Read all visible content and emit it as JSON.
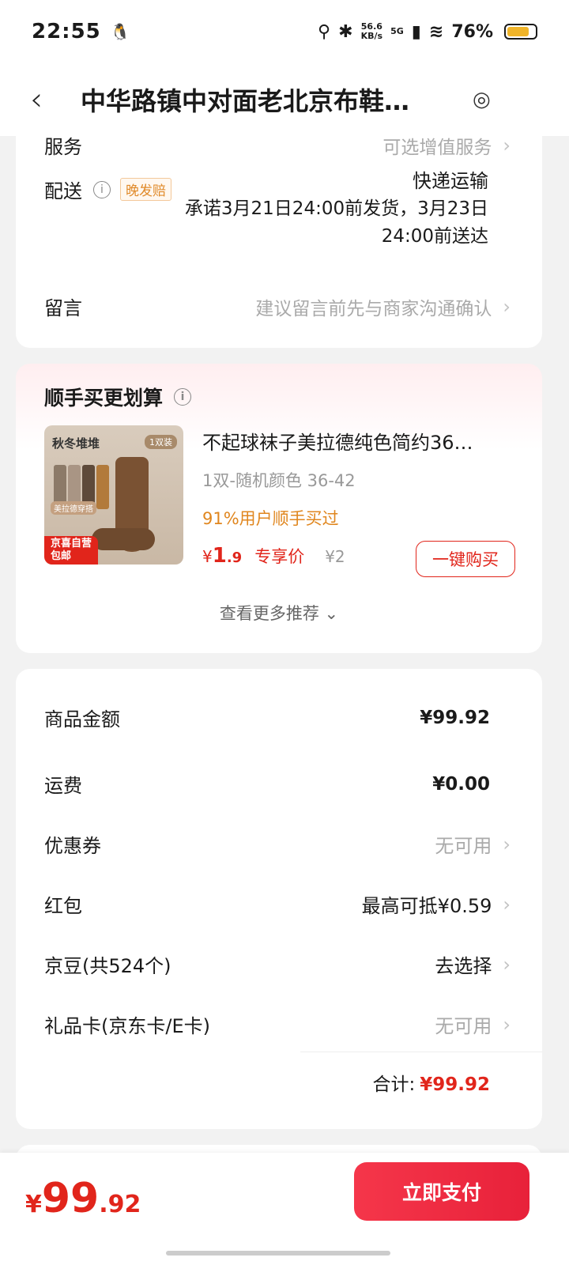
{
  "status_bar": {
    "time": "22:55",
    "net_speed_value": "56.6",
    "net_speed_unit": "KB/s",
    "signal_label": "5G",
    "battery": "76%"
  },
  "header": {
    "title": "中华路镇中对面老北京布鞋…"
  },
  "order_info": {
    "service_label": "服务",
    "service_value": "可选增值服务",
    "delivery_label": "配送",
    "delivery_tag": "晚发赔",
    "delivery_mode": "快递运输",
    "delivery_promise": "承诺3月21日24:00前发货，3月23日24:00前送达",
    "message_label": "留言",
    "message_placeholder": "建议留言前先与商家沟通确认"
  },
  "add_on": {
    "title": "顺手买更划算",
    "product_name": "不起球袜子美拉德纯色简约36…",
    "product_spec": "1双-随机颜色   36-42",
    "popularity": "91%用户顺手买过",
    "price_symbol": "¥",
    "price_int": "1",
    "price_dec": ".9",
    "price_tag": "专享价",
    "original_price": "¥2",
    "buy_button": "一键购买",
    "more_label": "查看更多推荐",
    "image_text_top": "秋冬堆堆",
    "image_text_pack": "1双装",
    "image_text_style": "美拉德穿搭",
    "image_badge_line1": "京喜自营",
    "image_badge_line2": "包邮"
  },
  "summary": {
    "goods_label": "商品金额",
    "goods_value": "¥99.92",
    "shipping_label": "运费",
    "shipping_value": "¥0.00",
    "coupon_label": "优惠券",
    "coupon_value": "无可用",
    "redpacket_label": "红包",
    "redpacket_value": "最高可抵¥0.59",
    "jingdou_label": "京豆(共524个)",
    "jingdou_value": "去选择",
    "giftcard_label": "礼品卡(京东卡/E卡)",
    "giftcard_value": "无可用",
    "total_label": "合计:",
    "total_value": "¥99.92"
  },
  "bottom_bar": {
    "price_symbol": "¥",
    "price_int": "99",
    "price_dec": ".92",
    "submit_label": "立即支付"
  },
  "colors": {
    "accent": "#e1251b",
    "orange": "#e0861e"
  }
}
